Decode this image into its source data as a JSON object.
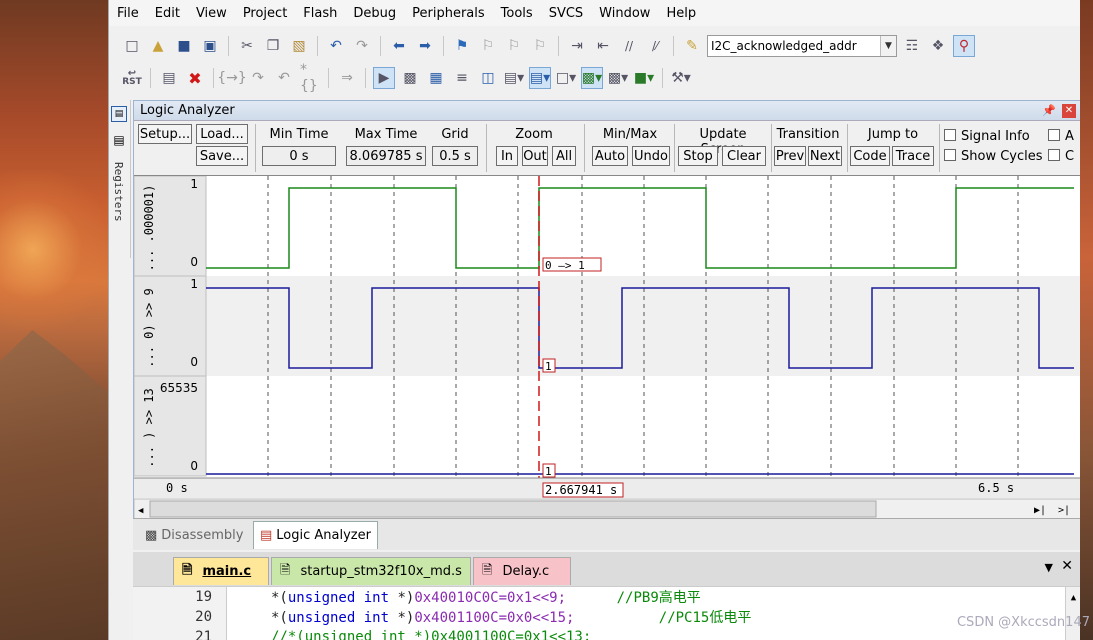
{
  "menu": [
    "File",
    "Edit",
    "View",
    "Project",
    "Flash",
    "Debug",
    "Peripherals",
    "Tools",
    "SVCS",
    "Window",
    "Help"
  ],
  "toolbar1": {
    "icons": [
      "new-file-icon",
      "open-folder-icon",
      "save-icon",
      "save-all-icon",
      "cut-icon",
      "copy-icon",
      "paste-icon",
      "undo-icon",
      "redo-icon",
      "nav-back-icon",
      "nav-forward-icon",
      "bookmark-icon",
      "bookmark-prev-icon",
      "bookmark-next-icon",
      "bookmark-clear-icon",
      "indent-icon",
      "unindent-icon",
      "comment-icon",
      "uncomment-icon"
    ],
    "find_combo": "I2C_acknowledged_addr",
    "right_icons": [
      "find-in-files-icon",
      "find-icon",
      "debug-session-icon"
    ]
  },
  "toolbar2": {
    "icons": [
      "reset-icon",
      "run-icon",
      "stop-icon",
      "step-into-icon",
      "step-over-icon",
      "step-out-icon",
      "run-to-cursor-icon",
      "show-next-statement-icon",
      "command-window-icon",
      "disassembly-window-icon",
      "symbols-window-icon",
      "registers-window-icon",
      "call-stack-icon",
      "watch-window-icon",
      "memory-window-icon",
      "serial-window-icon",
      "analysis-window-icon",
      "trace-window-icon",
      "system-viewer-icon",
      "toolbox-icon"
    ],
    "reset_label": "RST"
  },
  "sidebar": {
    "registers_label": "Registers"
  },
  "logic_analyzer": {
    "title": "Logic Analyzer",
    "buttons": {
      "setup": "Setup...",
      "load": "Load...",
      "save": "Save...",
      "zoom_in": "In",
      "zoom_out": "Out",
      "zoom_all": "All",
      "auto": "Auto",
      "undo": "Undo",
      "stop": "Stop",
      "clear": "Clear",
      "prev": "Prev",
      "next": "Next",
      "code": "Code",
      "trace": "Trace"
    },
    "labels": {
      "min_time": "Min Time",
      "max_time": "Max Time",
      "grid": "Grid",
      "zoom": "Zoom",
      "minmax": "Min/Max",
      "update_screen": "Update Screen",
      "transition": "Transition",
      "jump_to": "Jump to",
      "signal_info": "Signal Info",
      "show_cycles": "Show Cycles",
      "a_cut": "A",
      "c_cut": "C"
    },
    "values": {
      "min_time": "0 s",
      "max_time": "8.069785 s",
      "grid": "0.5 s"
    },
    "signals": [
      {
        "name": "... .000001)",
        "max": "1",
        "min": "0",
        "color": "#1a8a1a",
        "annot": "0 —> 1"
      },
      {
        "name": "... 0) >> 9",
        "max": "1",
        "min": "0",
        "color": "#1a1a9a",
        "annot": "1"
      },
      {
        "name": "... ) >> 13",
        "max": "65535",
        "min": "0",
        "color": "#1a1a9a",
        "annot": "1"
      }
    ],
    "axis": {
      "start": "0 s",
      "cursor": "2.667941 s",
      "end": "6.5 s"
    }
  },
  "bottom_tabs": {
    "disassembly": "Disassembly",
    "logic_analyzer": "Logic Analyzer"
  },
  "editor_tabs": [
    "main.c",
    "startup_stm32f10x_md.s",
    "Delay.c"
  ],
  "code": [
    {
      "ln": "19",
      "pre": "*(",
      "kw": "unsigned int",
      "mid": " *)",
      "num": "0x40010C0C=0x1<<9;",
      "cmt": "//PB9高电平"
    },
    {
      "ln": "20",
      "pre": "*(",
      "kw": "unsigned int",
      "mid": " *)",
      "num": "0x4001100C=0x0<<15;",
      "cmt": "//PC15低电平"
    },
    {
      "ln": "21",
      "full": "//*(unsigned int *)0x4001100C=0x1<<13;"
    }
  ],
  "watermark": "CSDN @Xkccsdn147"
}
